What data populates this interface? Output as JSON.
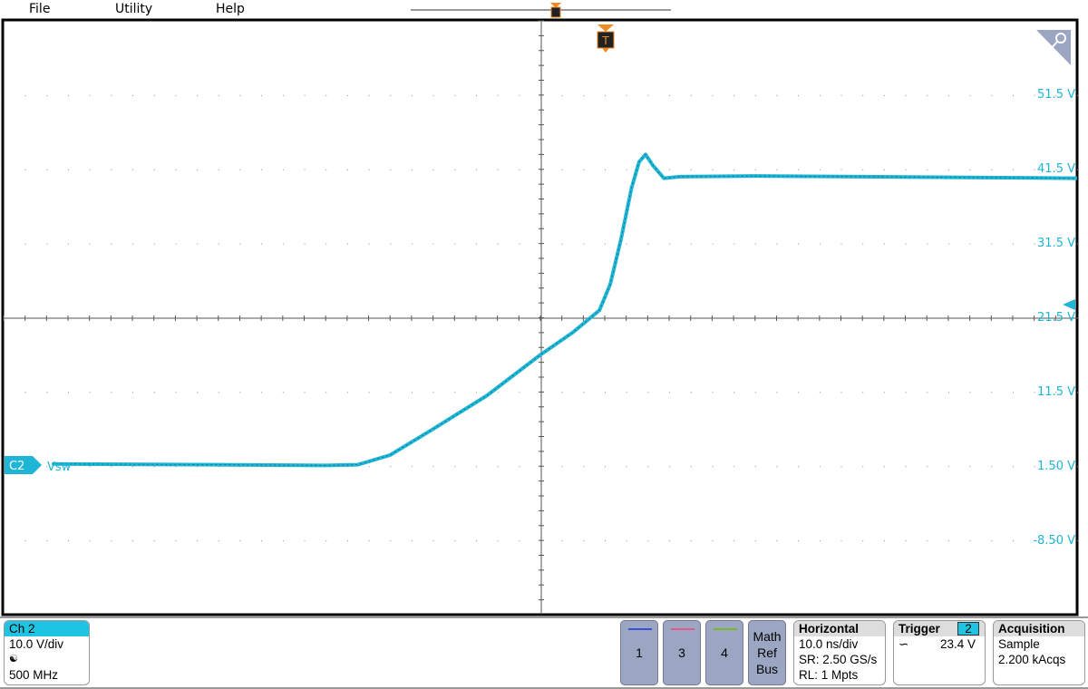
{
  "menu": [
    "File",
    "Utility",
    "Help"
  ],
  "channel": {
    "label": "C2",
    "name": "Vsw",
    "color": "#1fb5d6"
  },
  "axis_labels": [
    "51.5 V",
    "41.5 V",
    "31.5 V",
    "21.5 V",
    "11.5 V",
    "1.50 V",
    "-8.50 V"
  ],
  "trigger_marker": "T",
  "ch2_box": {
    "title": "Ch 2",
    "scale": "10.0 V/div",
    "icon": "probe-icon",
    "bandwidth": "500 MHz"
  },
  "channel_buttons": [
    {
      "label": "1",
      "color": "#3b4fd8"
    },
    {
      "label": "3",
      "color": "#e05a8a"
    },
    {
      "label": "4",
      "color": "#7ab82a"
    }
  ],
  "mrb": [
    "Math",
    "Ref",
    "Bus"
  ],
  "horizontal": {
    "title": "Horizontal",
    "scale": "10.0 ns/div",
    "sr": "SR: 2.50 GS/s",
    "rl": "RL: 1 Mpts"
  },
  "trigger": {
    "title": "Trigger",
    "source": "2",
    "level": "23.4 V",
    "slope": "rising"
  },
  "acquisition": {
    "title": "Acquisition",
    "mode": "Sample",
    "count": "2.200 kAcqs"
  },
  "chart_data": {
    "type": "line",
    "x_unit": "ns",
    "y_unit": "V",
    "xlim": [
      -50,
      50
    ],
    "ylim": [
      -18.5,
      61.5
    ],
    "grid": true,
    "series": [
      {
        "name": "Vsw",
        "color": "#1fb5d6",
        "x": [
          -50,
          -30,
          -20,
          -17,
          -14,
          -10,
          -5,
          0,
          3,
          5.5,
          6.5,
          7.5,
          8.5,
          9.2,
          9.8,
          10.5,
          11.5,
          13,
          20,
          30,
          40,
          50
        ],
        "y": [
          1.8,
          1.7,
          1.6,
          1.7,
          3,
          6.5,
          11,
          16.5,
          19.5,
          22.5,
          26,
          32,
          39,
          42.5,
          43.5,
          42,
          40.3,
          40.5,
          40.6,
          40.5,
          40.4,
          40.3
        ]
      }
    ]
  }
}
